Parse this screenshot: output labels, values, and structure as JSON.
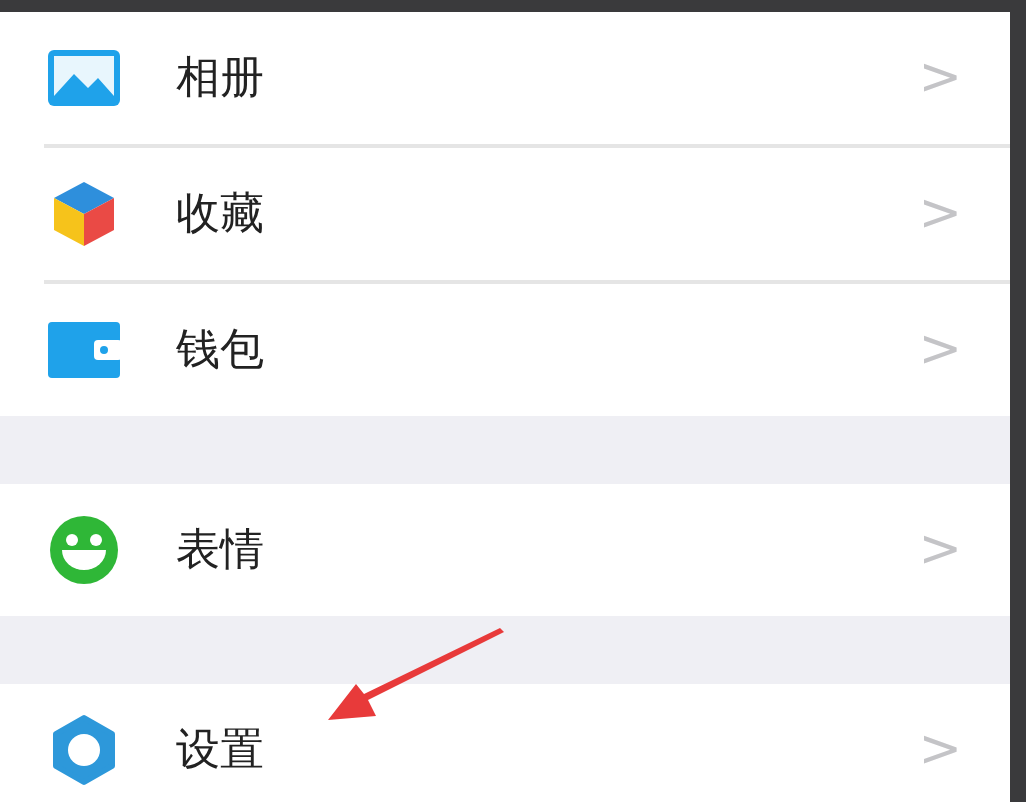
{
  "groups": [
    {
      "items": [
        {
          "label": "相册",
          "kind": "album"
        },
        {
          "label": "收藏",
          "kind": "favorites"
        },
        {
          "label": "钱包",
          "kind": "wallet"
        }
      ]
    },
    {
      "items": [
        {
          "label": "表情",
          "kind": "sticker"
        }
      ]
    },
    {
      "items": [
        {
          "label": "设置",
          "kind": "settings"
        }
      ]
    }
  ],
  "chevron": ">"
}
